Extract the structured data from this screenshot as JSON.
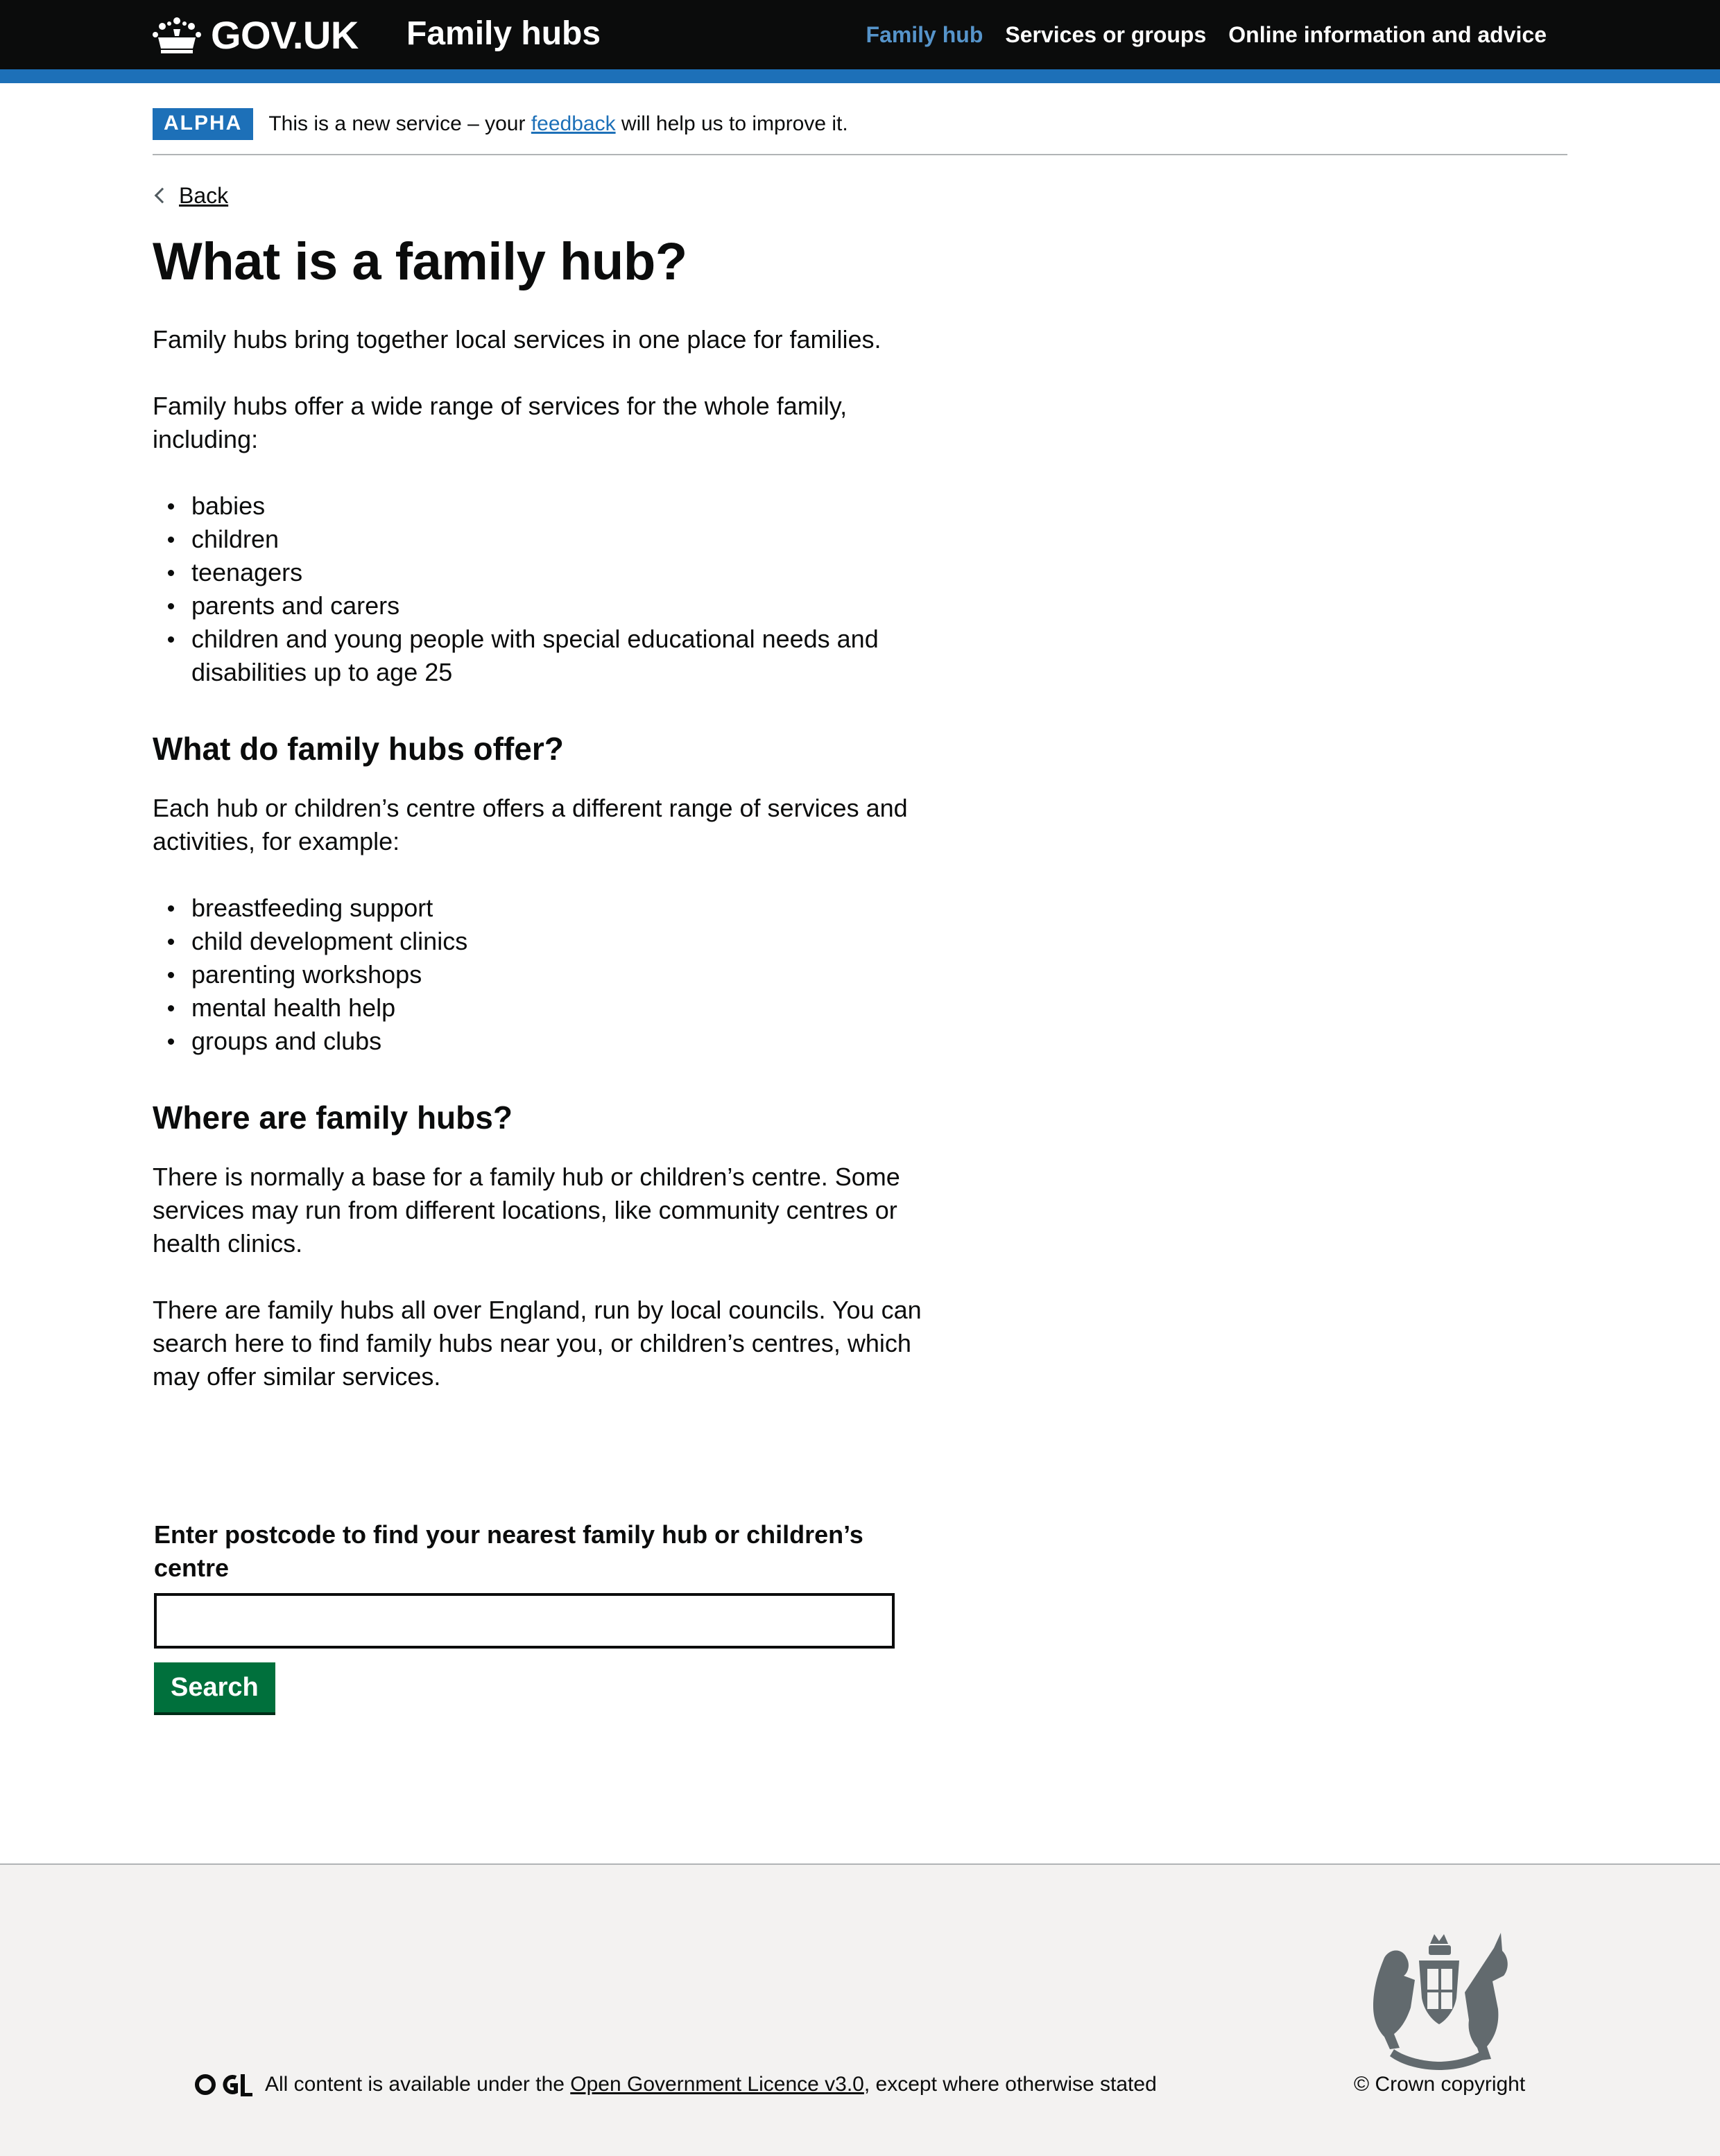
{
  "header": {
    "logo_text": "GOV.UK",
    "service_name": "Family hubs",
    "nav": [
      {
        "label": "Family hub",
        "active": true
      },
      {
        "label": "Services or groups",
        "active": false
      },
      {
        "label": "Online information and advice",
        "active": false
      }
    ]
  },
  "phase_banner": {
    "tag": "ALPHA",
    "text_before": "This is a new service – your ",
    "link": "feedback",
    "text_after": " will help us to improve it."
  },
  "back_link": "Back",
  "main": {
    "title": "What is a family hub?",
    "intro": "Family hubs bring together local services in one place for families.",
    "offer_intro": "Family hubs offer a wide range of services for the whole family, including:",
    "audience": [
      "babies",
      "children",
      "teenagers",
      "parents and carers",
      "children and young people with special educational needs and disabilities up to age 25"
    ],
    "offer_heading": "What do family hubs offer?",
    "offer_text": "Each hub or children’s centre offers a different range of services and activities, for example:",
    "offers": [
      "breastfeeding support",
      "child development clinics",
      "parenting workshops",
      "mental health help",
      "groups and clubs"
    ],
    "where_heading": "Where are family hubs?",
    "where_text_1": "There is normally a base for a family hub or children’s centre. Some services may run from different locations, like community centres or health clinics.",
    "where_text_2": "There are family hubs all over England, run by local councils. You can search here to find family hubs near you, or children’s centres, which may offer similar services."
  },
  "search": {
    "label": "Enter postcode to find your nearest family hub or children’s centre",
    "value": "",
    "button": "Search"
  },
  "footer": {
    "ogl_logo": "OGL",
    "licence_before": "All content is available under the ",
    "licence_link": "Open Government Licence v3.0",
    "licence_after": ", except where otherwise stated",
    "copyright": "© Crown copyright"
  },
  "colors": {
    "header_bg": "#0b0c0c",
    "brand_blue": "#1d70b8",
    "button_green": "#00703c",
    "footer_bg": "#f3f2f1"
  },
  "icons": [
    "crown-icon",
    "chevron-left-icon",
    "ogl-logo",
    "royal-coat-of-arms"
  ]
}
